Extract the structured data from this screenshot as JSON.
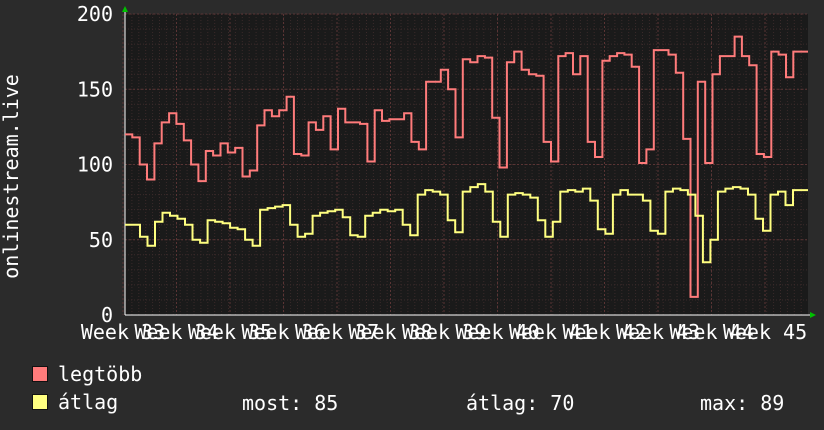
{
  "chart_data": {
    "type": "line",
    "ylabel": "onlinestream.live",
    "ylim": [
      0,
      200
    ],
    "yticks": [
      0,
      50,
      100,
      150,
      200
    ],
    "xtick_labels": [
      "Week 33",
      "Week 34",
      "Week 35",
      "Week 36",
      "Week 37",
      "Week 38",
      "Week 39",
      "Week 40",
      "Week 41",
      "Week 42",
      "Week 43",
      "Week 44",
      "Week 45"
    ],
    "grid": true,
    "colors": {
      "background": "#2b2b2b",
      "plot": "#1a1a1a",
      "grid": "#5a3434",
      "legtobb": "#ff7b7b",
      "atlag": "#ffff80"
    },
    "series": [
      {
        "name": "legtöbb",
        "values": [
          120,
          118,
          100,
          90,
          114,
          128,
          134,
          127,
          116,
          100,
          89,
          109,
          106,
          114,
          108,
          111,
          92,
          96,
          126,
          136,
          132,
          136,
          145,
          107,
          106,
          128,
          123,
          132,
          110,
          137,
          128,
          128,
          127,
          102,
          136,
          129,
          130,
          130,
          134,
          115,
          110,
          155,
          155,
          163,
          150,
          118,
          170,
          168,
          172,
          171,
          131,
          98,
          168,
          175,
          163,
          160,
          159,
          115,
          102,
          172,
          174,
          160,
          172,
          115,
          105,
          169,
          172,
          174,
          173,
          165,
          101,
          110,
          176,
          176,
          173,
          161,
          117,
          12,
          155,
          101,
          160,
          172,
          172,
          185,
          172,
          166,
          107,
          105,
          175,
          173,
          158,
          175,
          175
        ]
      },
      {
        "name": "átlag",
        "values": [
          60,
          60,
          52,
          46,
          62,
          68,
          66,
          64,
          60,
          50,
          48,
          63,
          62,
          61,
          58,
          57,
          50,
          46,
          70,
          71,
          72,
          73,
          60,
          52,
          54,
          66,
          68,
          69,
          70,
          65,
          53,
          52,
          66,
          68,
          70,
          69,
          70,
          60,
          53,
          80,
          83,
          82,
          80,
          63,
          55,
          82,
          85,
          87,
          82,
          62,
          52,
          80,
          81,
          80,
          78,
          63,
          52,
          62,
          82,
          83,
          82,
          84,
          76,
          57,
          54,
          80,
          83,
          80,
          80,
          76,
          56,
          54,
          82,
          84,
          83,
          80,
          66,
          35,
          50,
          82,
          84,
          85,
          84,
          80,
          64,
          56,
          80,
          82,
          73,
          83,
          83
        ]
      }
    ]
  },
  "legend": [
    {
      "label": "legtöbb",
      "color": "#ff7b7b"
    },
    {
      "label": "átlag",
      "color": "#ffff80"
    }
  ],
  "stats": {
    "most": "most: 85",
    "atlag": "átlag: 70",
    "max": "max: 89"
  }
}
